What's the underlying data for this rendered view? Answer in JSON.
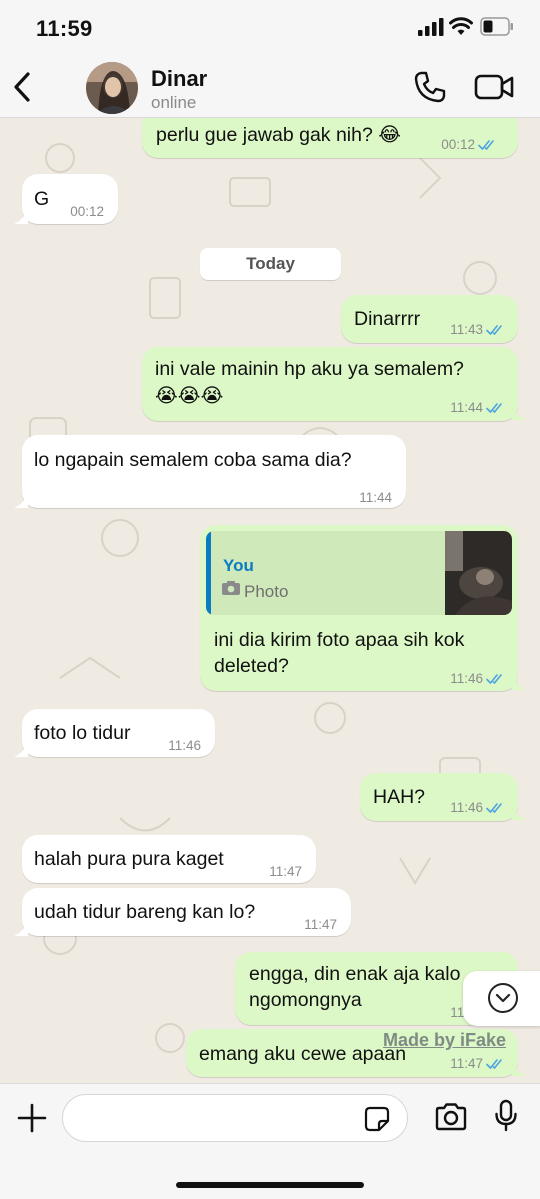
{
  "status_bar": {
    "time": "11:59"
  },
  "header": {
    "contact_name": "Dinar",
    "contact_status": "online"
  },
  "chat": {
    "day_label": "Today",
    "messages": [
      {
        "dir": "out",
        "text": "perlu gue jawab gak nih? 😂",
        "time": "00:12",
        "read": true
      },
      {
        "dir": "in",
        "text": "G",
        "time": "00:12"
      },
      {
        "dir": "out",
        "text": "Dinarrrr",
        "time": "11:43",
        "read": true
      },
      {
        "dir": "out",
        "text_line1": "ini vale mainin hp aku ya semalem?",
        "text_line2": "😭😭😭",
        "time": "11:44",
        "read": true
      },
      {
        "dir": "in",
        "text": "lo ngapain semalem coba sama dia?",
        "time": "11:44"
      },
      {
        "dir": "out",
        "reply": {
          "author": "You",
          "type": "Photo"
        },
        "text_line1": "ini dia kirim foto apaa sih kok",
        "text_line2": "deleted?",
        "time": "11:46",
        "read": true
      },
      {
        "dir": "in",
        "text": "foto lo tidur",
        "time": "11:46"
      },
      {
        "dir": "out",
        "text": "HAH?",
        "time": "11:46",
        "read": true
      },
      {
        "dir": "in",
        "text": "halah pura pura kaget",
        "time": "11:47"
      },
      {
        "dir": "in",
        "text": "udah tidur bareng kan lo?",
        "time": "11:47"
      },
      {
        "dir": "out",
        "text_line1": "engga, din enak aja kalo",
        "text_line2": "ngomongnya",
        "time": "11:47",
        "read": true
      },
      {
        "dir": "out",
        "text": "emang aku cewe apaan",
        "time": "11:47",
        "read": true
      }
    ]
  },
  "watermark": "Made by iFake",
  "input": {
    "placeholder": "",
    "value": ""
  },
  "colors": {
    "outgoing_bubble": "#dcf8c6",
    "incoming_bubble": "#ffffff",
    "chat_background": "#efeae2",
    "read_ticks": "#4fa3e0",
    "reply_accent": "#0a7cc4"
  },
  "icons": [
    "back-chevron-icon",
    "phone-icon",
    "video-camera-icon",
    "double-check-icon",
    "camera-icon",
    "chevron-down-icon",
    "plus-icon",
    "sticker-icon",
    "microphone-icon"
  ]
}
